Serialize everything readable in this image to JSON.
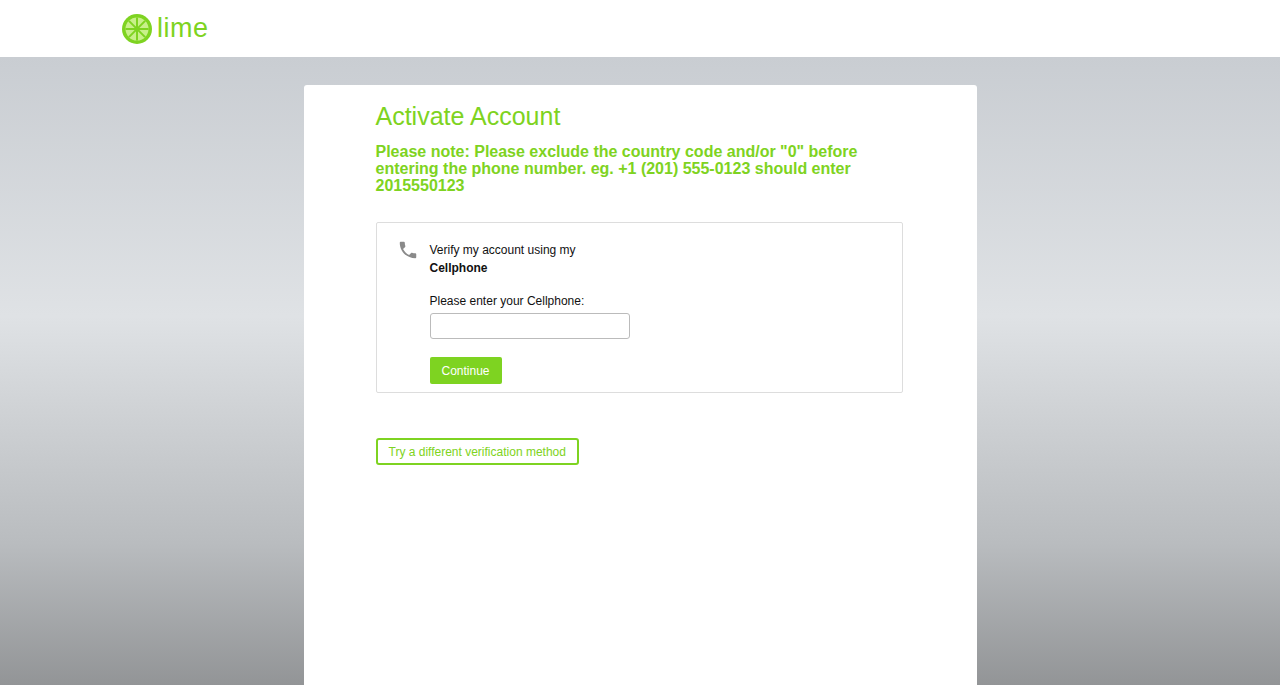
{
  "header": {
    "logo": "lime"
  },
  "page": {
    "title": "Activate Account",
    "note": "Please note: Please exclude the country code and/or \"0\" before entering the phone number. eg. +1 (201) 555-0123 should enter 2015550123"
  },
  "verification": {
    "intro": "Verify my account using my",
    "method": "Cellphone",
    "field_label": "Please enter your Cellphone:",
    "field_value": "",
    "button": "Continue"
  },
  "alternate_button": "Try a different verification method"
}
